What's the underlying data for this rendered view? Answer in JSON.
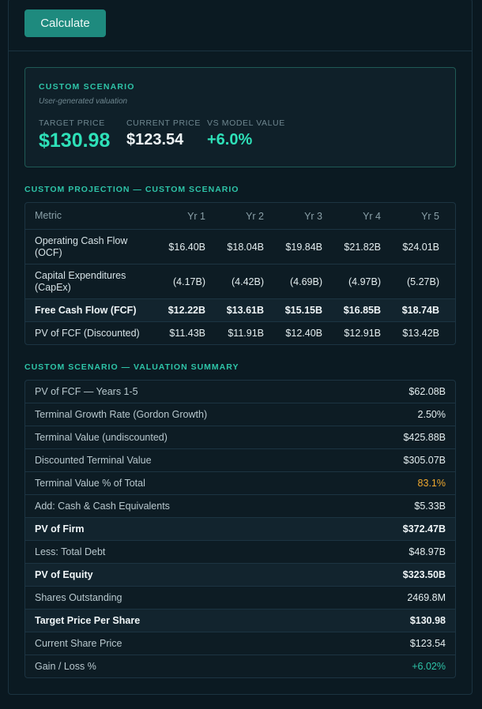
{
  "calculate_label": "Calculate",
  "scenario": {
    "label": "CUSTOM SCENARIO",
    "subtitle": "User-generated valuation",
    "target_price_label": "TARGET PRICE",
    "target_price": "$130.98",
    "current_price_label": "CURRENT PRICE",
    "current_price": "$123.54",
    "vs_model_label": "VS MODEL VALUE",
    "vs_model_value": "+6.0%"
  },
  "projection": {
    "title": "CUSTOM PROJECTION — CUSTOM SCENARIO",
    "headers": [
      "Metric",
      "Yr 1",
      "Yr 2",
      "Yr 3",
      "Yr 4",
      "Yr 5"
    ],
    "rows": [
      {
        "label": "Operating Cash Flow (OCF)",
        "values": [
          "$16.40B",
          "$18.04B",
          "$19.84B",
          "$21.82B",
          "$24.01B"
        ]
      },
      {
        "label": "Capital Expenditures (CapEx)",
        "values": [
          "(4.17B)",
          "(4.42B)",
          "(4.69B)",
          "(4.97B)",
          "(5.27B)"
        ]
      },
      {
        "label": "Free Cash Flow (FCF)",
        "values": [
          "$12.22B",
          "$13.61B",
          "$15.15B",
          "$16.85B",
          "$18.74B"
        ]
      },
      {
        "label": "PV of FCF (Discounted)",
        "values": [
          "$11.43B",
          "$11.91B",
          "$12.40B",
          "$12.91B",
          "$13.42B"
        ]
      }
    ]
  },
  "summary": {
    "title": "CUSTOM SCENARIO — VALUATION SUMMARY",
    "rows": [
      {
        "label": "PV of FCF — Years 1-5",
        "value": "$62.08B"
      },
      {
        "label": "Terminal Growth Rate (Gordon Growth)",
        "value": "2.50%"
      },
      {
        "label": "Terminal Value (undiscounted)",
        "value": "$425.88B"
      },
      {
        "label": "Discounted Terminal Value",
        "value": "$305.07B"
      },
      {
        "label": "Terminal Value % of Total",
        "value": "83.1%"
      },
      {
        "label": "Add: Cash & Cash Equivalents",
        "value": "$5.33B"
      },
      {
        "label": "PV of Firm",
        "value": "$372.47B"
      },
      {
        "label": "Less: Total Debt",
        "value": "$48.97B"
      },
      {
        "label": "PV of Equity",
        "value": "$323.50B"
      },
      {
        "label": "Shares Outstanding",
        "value": "2469.8M"
      },
      {
        "label": "Target Price Per Share",
        "value": "$130.98"
      },
      {
        "label": "Current Share Price",
        "value": "$123.54"
      },
      {
        "label": "Gain / Loss %",
        "value": "+6.02%"
      }
    ]
  },
  "colors": {
    "accent": "#2ec4a8",
    "highlight": "#2ee0b8",
    "warning": "#f0a92e",
    "button": "#1e8a7e"
  }
}
